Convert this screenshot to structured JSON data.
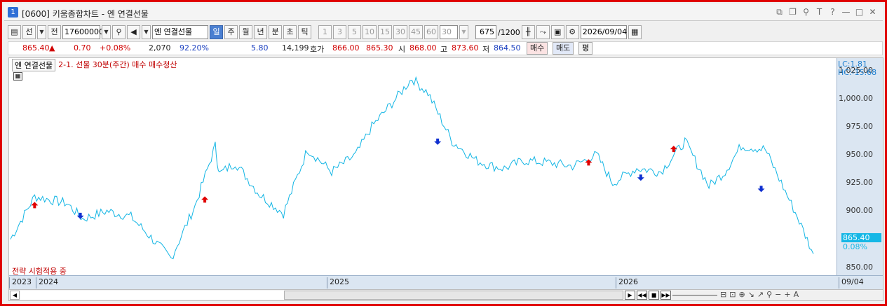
{
  "window": {
    "number": "1",
    "title": "[0600] 키움종합차트 - 엔 연결선물",
    "controls": [
      "restore-icon",
      "copy-icon",
      "pin-icon",
      "text-icon",
      "help-icon",
      "minimize-icon",
      "maximize-icon",
      "close-icon"
    ],
    "control_glyphs": [
      "⧉",
      "❐",
      "⚲",
      "T",
      "?",
      "—",
      "□",
      "✕"
    ]
  },
  "toolbar": {
    "type_select": "선",
    "prev_label": "전",
    "code": "17600000",
    "name": "엔 연결선물",
    "periods": [
      {
        "label": "일",
        "selected": true
      },
      {
        "label": "주",
        "selected": false
      },
      {
        "label": "월",
        "selected": false
      },
      {
        "label": "년",
        "selected": false
      },
      {
        "label": "분",
        "selected": false
      },
      {
        "label": "초",
        "selected": false
      },
      {
        "label": "틱",
        "selected": false
      }
    ],
    "intervals": [
      "1",
      "3",
      "5",
      "10",
      "15",
      "30",
      "45",
      "60"
    ],
    "interval_value": "30",
    "count_value": "675",
    "count_total": "/1200",
    "date": "2026/09/04"
  },
  "quote": {
    "price": "865.40",
    "change": "0.70",
    "change_pct": "+0.08%",
    "volume": "2,070",
    "ratio": "92.20%",
    "v1": "5.80",
    "v2": "14,199",
    "hoga_label": "호가",
    "hoga_bid": "866.00",
    "hoga_ask": "865.30",
    "open_label": "시",
    "open": "868.00",
    "high_label": "고",
    "high": "873.60",
    "low_label": "저",
    "low": "864.50",
    "buy_btn": "매수",
    "sell_btn": "매도",
    "eval_btn": "평"
  },
  "chart_header": {
    "item": "엔 연결선물",
    "strategy": "2-1. 선물 30분(주간) 매수 매수청산",
    "lc": "LC:1.81",
    "hc": "HC:-15.68",
    "strategy_status": "전략 시험적용 중",
    "current_price_tag": "865.40",
    "current_pct_tag": "0.08%"
  },
  "chart_data": {
    "type": "line",
    "y_ticks": [
      "1,025.00",
      "1,000.00",
      "975.00",
      "950.00",
      "925.00",
      "900.00",
      "875.00",
      "850.00"
    ],
    "ylim": [
      843,
      1036
    ],
    "x_labels": [
      "2023",
      "2024",
      "2025",
      "2026"
    ],
    "right_date": "09/04",
    "series": [
      {
        "color": "#12b5e4",
        "x": [
          0,
          0.03,
          0.07,
          0.09,
          0.12,
          0.15,
          0.2,
          0.23,
          0.255,
          0.26,
          0.28,
          0.31,
          0.34,
          0.37,
          0.4,
          0.43,
          0.45,
          0.48,
          0.5,
          0.52,
          0.55,
          0.58,
          0.6,
          0.615,
          0.64,
          0.67,
          0.7,
          0.73,
          0.75,
          0.78,
          0.81,
          0.84,
          0.87,
          0.89,
          0.91,
          0.94,
          0.96,
          0.98,
          1.0
        ],
        "values": [
          875,
          913,
          907,
          893,
          900,
          895,
          858,
          905,
          958,
          933,
          943,
          915,
          898,
          955,
          935,
          950,
          975,
          1000,
          1018,
          1005,
          962,
          945,
          940,
          938,
          945,
          943,
          940,
          950,
          925,
          938,
          935,
          962,
          922,
          935,
          958,
          955,
          925,
          895,
          862
        ]
      }
    ],
    "buy_signals": [
      {
        "x": 0.03,
        "y": 905
      },
      {
        "x": 0.242,
        "y": 910
      },
      {
        "x": 0.72,
        "y": 943
      },
      {
        "x": 0.826,
        "y": 955
      }
    ],
    "sell_signals": [
      {
        "x": 0.087,
        "y": 896
      },
      {
        "x": 0.532,
        "y": 962
      },
      {
        "x": 0.785,
        "y": 930
      },
      {
        "x": 0.935,
        "y": 920
      }
    ]
  },
  "scroll": {
    "tools": [
      "zoom-slider-icon",
      "chart-tool-icon",
      "draw-icon",
      "line-tool-icon",
      "search-icon",
      "minus-icon",
      "plus-icon",
      "text-size-icon"
    ],
    "tool_glyphs": [
      "⊟",
      "⊡",
      "⊕",
      "↘",
      "↗",
      "⚲",
      "−",
      "+",
      "A"
    ]
  }
}
